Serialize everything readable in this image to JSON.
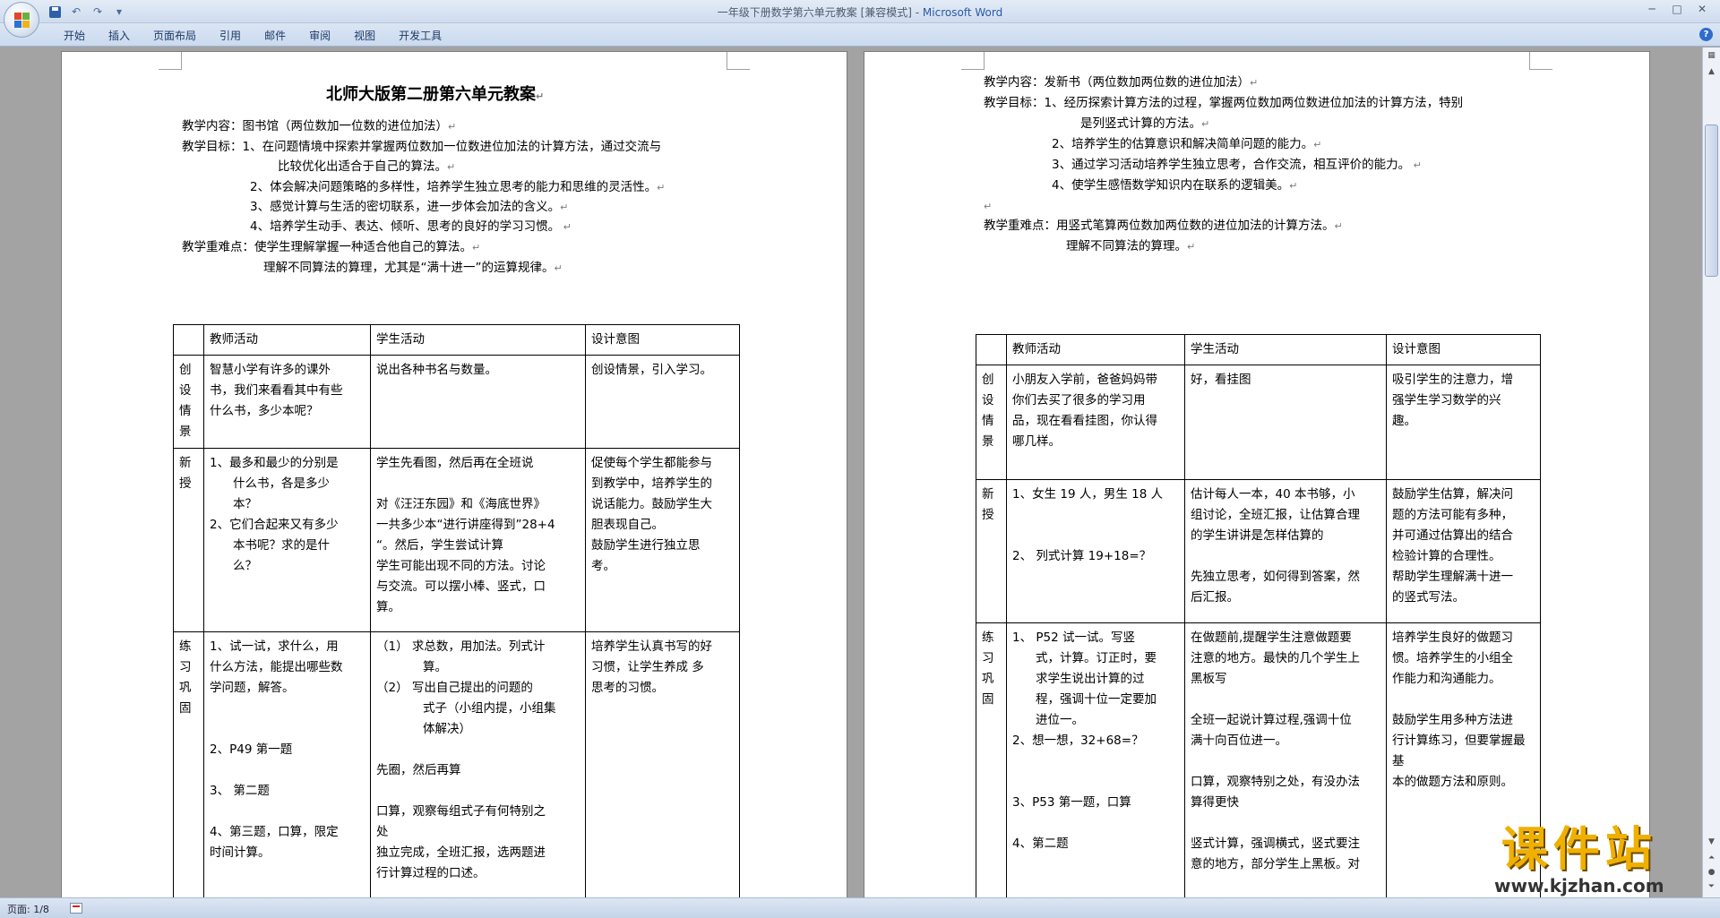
{
  "window": {
    "title": "一年级下册数学第六单元教案 [兼容模式] - ",
    "app_name": "Microsoft Word",
    "qat_customize": "▾"
  },
  "ribbon": {
    "tabs": [
      "开始",
      "插入",
      "页面布局",
      "引用",
      "邮件",
      "审阅",
      "视图",
      "开发工具"
    ],
    "help": "?"
  },
  "status": {
    "page": "页面: 1/8"
  },
  "watermark": {
    "main": "课件站",
    "url": "www.kjzhan.com"
  },
  "page1": {
    "title": "北师大版第二册第六单元教案",
    "content": "教学内容：图书馆（两位数加一位数的进位加法）",
    "goal_label": "教学目标：",
    "goals": [
      "1、在问题情境中探索并掌握两位数加一位数进位加法的计算方法，通过交流与",
      "比较优化出适合于自己的算法。",
      "2、体会解决问题策略的多样性，培养学生独立思考的能力和思维的灵活性。",
      "3、感觉计算与生活的密切联系，进一步体会加法的含义。",
      "4、培养学生动手、表达、倾听、思考的良好的学习习惯。"
    ],
    "key_label": "教学重难点：",
    "key_points": [
      "使学生理解掌握一种适合他自己的算法。",
      "理解不同算法的算理，尤其是“满十进一”的运算规律。"
    ],
    "table": {
      "headers": [
        "",
        "教师活动",
        "学生活动",
        "设计意图"
      ],
      "rows": [
        {
          "stage": [
            "创",
            "设",
            "情",
            "景"
          ],
          "teacher": [
            "智慧小学有许多的课外",
            "书，我们来看看其中有些",
            "什么书，多少本呢？"
          ],
          "student": [
            "说出各种书名与数量。"
          ],
          "intent": [
            "创设情景，引入学习。"
          ]
        },
        {
          "stage": [
            "新",
            "授"
          ],
          "teacher": [
            "1、最多和最少的分别是",
            "什么书，各是多少",
            "本？",
            "2、它们合起来又有多少",
            "本书呢？求的是什",
            "么？"
          ],
          "student": [
            "学生先看图，然后再在全班说",
            "",
            "对《汪汪东园》和《海底世界》",
            "一共多少本“进行讲座得到”28+4",
            "“。然后，学生尝试计算",
            "学生可能出现不同的方法。讨论",
            "与交流。可以摆小棒、竖式，口",
            "算。"
          ],
          "intent": [
            "促使每个学生都能参与",
            "到教学中，培养学生的",
            "说话能力。鼓励学生大",
            "胆表现自己。",
            "鼓励学生进行独立思",
            "考。"
          ]
        },
        {
          "stage": [
            "练",
            "习",
            "巩",
            "固"
          ],
          "teacher": [
            "1、试一试，求什么，用",
            "什么方法，能提出哪些数",
            "学问题，解答。",
            "",
            "",
            "2、P49 第一题",
            "",
            "3、 第二题",
            "",
            "4、第三题，口算，限定",
            "时间计算。"
          ],
          "student": [
            "（1）   求总数，用加法。列式计",
            "算。",
            "（2）   写出自己提出的问题的",
            "式子（小组内提，小组集",
            "体解决）",
            "",
            "先圈，然后再算",
            "",
            "口算，观察每组式子有何特别之",
            "处",
            "独立完成，全班汇报，选两题进",
            "行计算过程的口述。"
          ],
          "intent": [
            "培养学生认真书写的好",
            "习惯，让学生养成  多",
            "思考的习惯。"
          ]
        }
      ]
    }
  },
  "page2": {
    "content": "教学内容：发新书（两位数加两位数的进位加法）",
    "goal_label": "教学目标：",
    "goals": [
      "1、经历探索计算方法的过程，掌握两位数加两位数进位加法的计算方法，特别",
      "是列竖式计算的方法。",
      "2、培养学生的估算意识和解决简单问题的能力。",
      "3、通过学习活动培养学生独立思考，合作交流，相互评价的能力。",
      "4、使学生感悟数学知识内在联系的逻辑美。"
    ],
    "key_label": "教学重难点：",
    "key_points": [
      "用竖式笔算两位数加两位数的进位加法的计算方法。",
      "理解不同算法的算理。"
    ],
    "table": {
      "headers": [
        "",
        "教师活动",
        "学生活动",
        "设计意图"
      ],
      "rows": [
        {
          "stage": [
            "创",
            "设",
            "情",
            "景"
          ],
          "teacher": [
            "小朋友入学前，爸爸妈妈带",
            "你们去买了很多的学习用",
            "品，现在看看挂图，你认得",
            "哪几样。"
          ],
          "student": [
            "好，看挂图"
          ],
          "intent": [
            "吸引学生的注意力，增",
            "强学生学习数学的兴",
            "趣。"
          ]
        },
        {
          "stage": [
            "新",
            "授"
          ],
          "teacher": [
            "1、女生 19 人，男生 18 人",
            "",
            "",
            "2、 列式计算 19+18=？"
          ],
          "student": [
            "估计每人一本，40 本书够，小",
            "组讨论，全班汇报，让估算合理",
            "的学生讲讲是怎样估算的",
            "",
            "先独立思考，如何得到答案，然",
            "后汇报。"
          ],
          "intent": [
            "鼓励学生估算，解决问",
            "题的方法可能有多种，",
            "并可通过估算出的结合",
            "检验计算的合理性。",
            "帮助学生理解满十进一",
            "的竖式写法。"
          ]
        },
        {
          "stage": [
            "练",
            "习",
            "巩",
            "固"
          ],
          "teacher": [
            "1、     P52 试一试。写竖",
            "式，计算。订正时，要",
            "求学生说出计算的过",
            "程，强调十位一定要加",
            "进位一。",
            "2、想一想，32+68=？",
            "",
            "",
            "3、P53 第一题，口算",
            "",
            "4、第二题"
          ],
          "student": [
            "在做题前,提醒学生注意做题要",
            "注意的地方。最快的几个学生上",
            "黑板写",
            "",
            "全班一起说计算过程,强调十位",
            "满十向百位进一。",
            "",
            "口算，观察特别之处，有没办法",
            "算得更快",
            "",
            "竖式计算，强调横式，竖式要注",
            "意的地方，部分学生上黑板。对"
          ],
          "intent": [
            "培养学生良好的做题习",
            "惯。培养学生的小组全",
            "作能力和沟通能力。",
            "",
            "鼓励学生用多种方法进",
            "行计算练习，但要掌握最基",
            "本的做题方法和原则。"
          ]
        }
      ]
    }
  }
}
